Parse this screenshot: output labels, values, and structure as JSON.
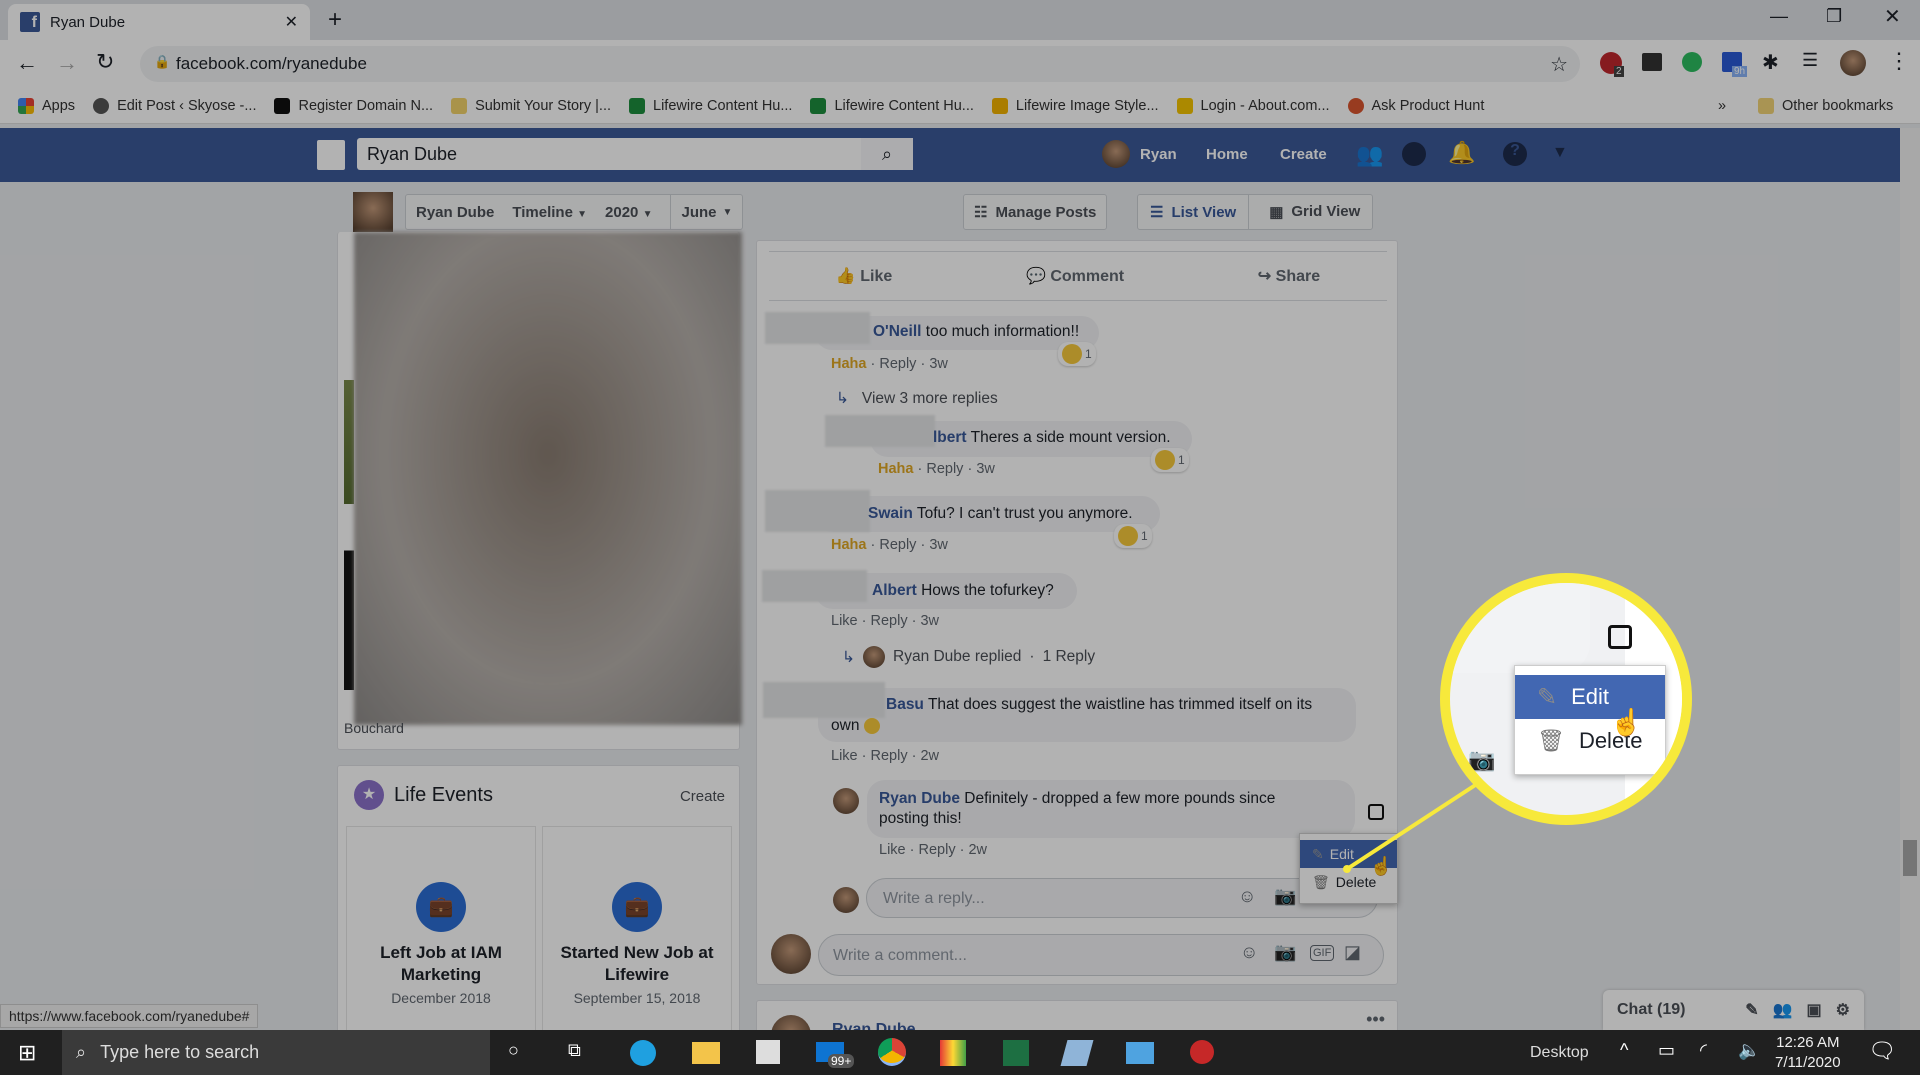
{
  "browser": {
    "tab_title": "Ryan Dube",
    "url": "facebook.com/ryanedube",
    "extension_badges": [
      "2",
      "9h"
    ],
    "bookmarks": [
      "Apps",
      "Edit Post ‹ Skyose -...",
      "Register Domain N...",
      "Submit Your Story |...",
      "Lifewire Content Hu...",
      "Lifewire Content Hu...",
      "Lifewire Image Style...",
      "Login - About.com...",
      "Ask Product Hunt"
    ],
    "bookmarks_overflow": "»",
    "other_bookmarks": "Other bookmarks",
    "status_url": "https://www.facebook.com/ryanedube#"
  },
  "fb": {
    "search_value": "Ryan Dube",
    "nav": {
      "user": "Ryan",
      "home": "Home",
      "create": "Create"
    },
    "brand_color": "#3b5998"
  },
  "profile_bar": {
    "name": "Ryan Dube",
    "timeline": "Timeline",
    "year": "2020",
    "month": "June",
    "manage_posts": "Manage Posts",
    "list_view": "List View",
    "grid_view": "Grid View"
  },
  "left": {
    "caption": "Bouchard",
    "life_events": {
      "title": "Life Events",
      "create": "Create",
      "items": [
        {
          "title": "Left Job at IAM Marketing",
          "date": "December 2018"
        },
        {
          "title": "Started New Job at Lifewire",
          "date": "September 15, 2018"
        }
      ]
    }
  },
  "post": {
    "like": "Like",
    "comment": "Comment",
    "share": "Share",
    "comments": [
      {
        "name": "O'Neill",
        "text": "too much information!!",
        "reaction": "Haha",
        "reply": "Reply",
        "time": "3w",
        "count": "1"
      },
      {
        "name": "lbert",
        "text": "Theres a side mount version.",
        "reaction": "Haha",
        "reply": "Reply",
        "time": "3w",
        "count": "1"
      },
      {
        "name": "Swain",
        "text": "Tofu? I can't trust you anymore.",
        "reaction": "Haha",
        "reply": "Reply",
        "time": "3w",
        "count": "1"
      },
      {
        "name": "Albert",
        "text": "Hows the tofurkey?",
        "reaction": "Like",
        "reply": "Reply",
        "time": "3w"
      },
      {
        "name": "Basu",
        "text": "That does suggest the waistline has trimmed itself on its",
        "text2": "own",
        "reaction": "Like",
        "reply": "Reply",
        "time": "2w"
      },
      {
        "name": "Ryan Dube",
        "text": "Definitely - dropped a few more pounds since",
        "text2": "posting this!",
        "reaction": "Like",
        "reply": "Reply",
        "time": "2w"
      }
    ],
    "view_more": "View 3 more replies",
    "replied": "Ryan Dube replied",
    "replied_count": "1 Reply",
    "reply_placeholder": "Write a reply...",
    "comment_placeholder": "Write a comment...",
    "gif": "GIF",
    "menu": {
      "edit": "Edit",
      "delete": "Delete"
    },
    "next_post_author": "Ryan Dube"
  },
  "chat": {
    "label": "Chat (19)"
  },
  "taskbar": {
    "search": "Type here to search",
    "badge": "99+",
    "desktop": "Desktop",
    "time": "12:26 AM",
    "date": "7/11/2020"
  },
  "highlight_color": "#f7e93b"
}
